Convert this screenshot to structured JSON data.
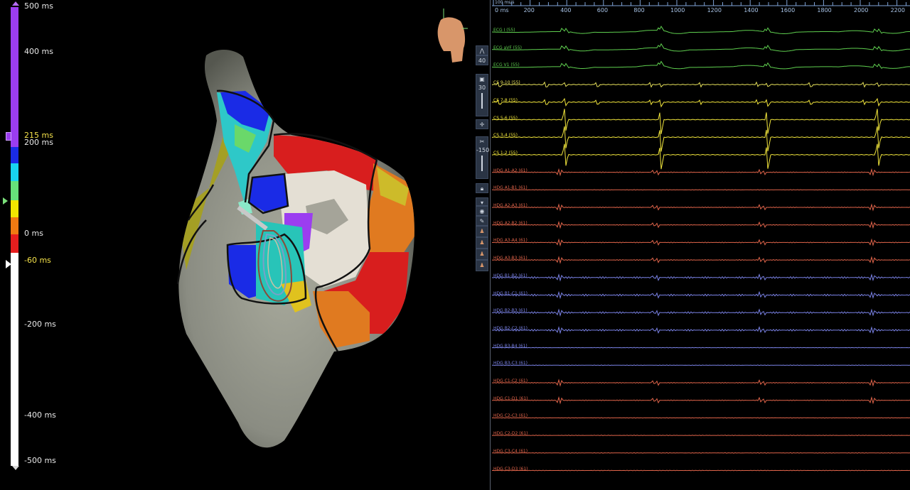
{
  "colorbar": {
    "labels": {
      "max": "500 ms",
      "l400": "400 ms",
      "window_upper": "215 ms",
      "l200": "200 ms",
      "zero": "0 ms",
      "window_lower": "-60 ms",
      "lneg200": "-200 ms",
      "lneg400": "-400 ms",
      "min": "-500 ms"
    },
    "colors": {
      "purple": "#9b3df0",
      "blue": "#1a2be6",
      "cyan": "#18d4f0",
      "green": "#66e07a",
      "yellow": "#f2e600",
      "orange": "#f07a12",
      "red": "#e61e1e",
      "white": "#ffffff",
      "highlight": "#f5e24a"
    }
  },
  "toolbar": {
    "gain_value": "40",
    "filter_value": "30",
    "offset_value": "-150"
  },
  "timeline": {
    "unit_label": "100 ms/s",
    "ticks": [
      "0 ms",
      "200",
      "400",
      "600",
      "800",
      "1000",
      "1200",
      "1400",
      "1600",
      "1800",
      "2000",
      "2200"
    ]
  },
  "channels": [
    {
      "label": "ECG I (55)",
      "color": "#5fcf4f",
      "kind": "ecg"
    },
    {
      "label": "ECG aVF (55)",
      "color": "#5fcf4f",
      "kind": "ecg"
    },
    {
      "label": "ECG V1 (55)",
      "color": "#5fcf4f",
      "kind": "ecg"
    },
    {
      "label": "CS 9-10 (55)",
      "color": "#e6e05a",
      "kind": "cs_small"
    },
    {
      "label": "CS 7-8 (55)",
      "color": "#f2e63c",
      "kind": "cs_mid"
    },
    {
      "label": "CS 5-6 (55)",
      "color": "#f2e63c",
      "kind": "cs_big"
    },
    {
      "label": "CS 3-4 (55)",
      "color": "#f2e63c",
      "kind": "cs_big"
    },
    {
      "label": "CS 1-2 (55)",
      "color": "#f2e63c",
      "kind": "cs_big"
    },
    {
      "label": "HDG A1-A2 (61)",
      "color": "#e0644a",
      "kind": "hdg"
    },
    {
      "label": "HDG A1-B1 (61)",
      "color": "#e0644a",
      "kind": "hdg_flat"
    },
    {
      "label": "HDG A2-A3 (61)",
      "color": "#e0644a",
      "kind": "hdg"
    },
    {
      "label": "HDG A2-B2 (61)",
      "color": "#e0644a",
      "kind": "hdg"
    },
    {
      "label": "HDG A3-A4 (61)",
      "color": "#e0644a",
      "kind": "hdg"
    },
    {
      "label": "HDG A3-B3 (61)",
      "color": "#e0644a",
      "kind": "hdg"
    },
    {
      "label": "HDG B1-B2 (61)",
      "color": "#7a82e6",
      "kind": "hdg_noisy"
    },
    {
      "label": "HDG B1-C1 (61)",
      "color": "#7a82e6",
      "kind": "hdg_noisy"
    },
    {
      "label": "HDG B2-B3 (61)",
      "color": "#7a82e6",
      "kind": "hdg_noisy"
    },
    {
      "label": "HDG B2-C2 (61)",
      "color": "#7a82e6",
      "kind": "hdg_noisy"
    },
    {
      "label": "HDG B3-B4 (61)",
      "color": "#7a82e6",
      "kind": "hdg_flat"
    },
    {
      "label": "HDG B3-C3 (61)",
      "color": "#7a82e6",
      "kind": "hdg_flat"
    },
    {
      "label": "HDG C1-C2 (61)",
      "color": "#e0644a",
      "kind": "hdg"
    },
    {
      "label": "HDG C1-D1 (61)",
      "color": "#e0644a",
      "kind": "hdg"
    },
    {
      "label": "HDG C2-C3 (61)",
      "color": "#e0644a",
      "kind": "hdg_flat"
    },
    {
      "label": "HDG C2-D2 (61)",
      "color": "#e0644a",
      "kind": "hdg_flat"
    },
    {
      "label": "HDG C3-C4 (61)",
      "color": "#e0644a",
      "kind": "hdg_flat"
    },
    {
      "label": "HDG C3-D3 (61)",
      "color": "#e0644a",
      "kind": "hdg_flat"
    }
  ]
}
